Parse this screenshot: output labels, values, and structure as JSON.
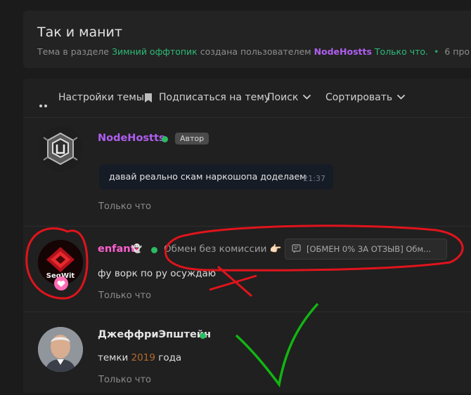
{
  "thread": {
    "title": "Так и манит",
    "meta_prefix": "Тема в разделе",
    "section": "Зимний оффтопик",
    "meta_middle": "создана пользователем",
    "author": "NodeHostts",
    "created": "Только что.",
    "dot": "•",
    "replies": "6 про"
  },
  "toolbar": {
    "settings": "Настройки темы",
    "subscribe": "Подписаться на тему",
    "search": "Поиск",
    "sort": "Сортировать"
  },
  "posts": [
    {
      "username": "NodeHostts",
      "badge": "Автор",
      "message": "давай реально скам наркошопа доделаем",
      "message_time": "21:37",
      "time": "Только что"
    },
    {
      "username": "enfant",
      "user_emoji": "👻",
      "avatar_text": "SegWit",
      "status": "Обмен без комиссии",
      "status_emoji": "👉🏻",
      "trade_link": "[ОБМЕН 0% ЗА ОТЗЫВ] Обм...",
      "text": "фу ворк по ру осуждаю",
      "time": "Только что"
    },
    {
      "username": "ДжеффриЭпштейн",
      "text_before": "темки ",
      "text_year": "2019",
      "text_after": " года",
      "time": "Только что"
    }
  ],
  "colors": {
    "accent_green": "#2dbb78",
    "username_purple": "#b05ef0",
    "enfant_pink": "#ff5fd0",
    "annotation_red": "#e0141c",
    "annotation_green": "#12b512"
  }
}
